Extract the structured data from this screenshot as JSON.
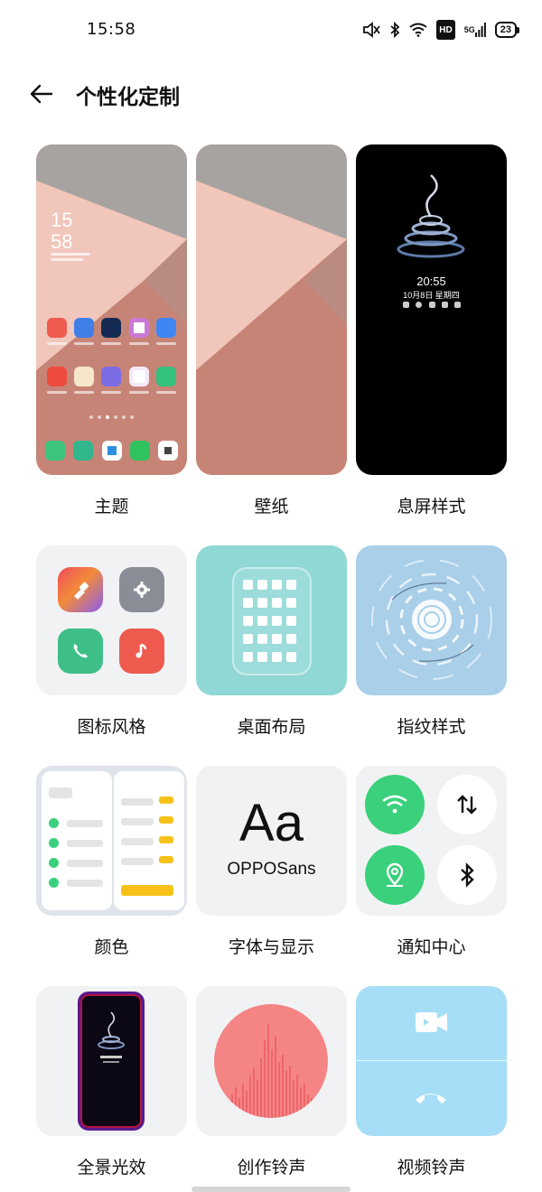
{
  "status_bar": {
    "time": "15:58",
    "battery": "23",
    "hd": "HD",
    "signal": "5G"
  },
  "header": {
    "title": "个性化定制",
    "back_icon": "arrow-left-icon"
  },
  "items": {
    "theme": {
      "label": "主题",
      "clock": "15\n58"
    },
    "wallpaper": {
      "label": "壁纸"
    },
    "aod": {
      "label": "息屏样式",
      "time": "20:55",
      "date": "10月8日 星期四"
    },
    "icon_style": {
      "label": "图标风格"
    },
    "layout": {
      "label": "桌面布局"
    },
    "fingerprint": {
      "label": "指纹样式"
    },
    "color": {
      "label": "颜色"
    },
    "font": {
      "label": "字体与显示",
      "sample": "Aa",
      "font_name": "OPPOSans"
    },
    "notification": {
      "label": "通知中心"
    },
    "panorama": {
      "label": "全景光效"
    },
    "ringtone": {
      "label": "创作铃声"
    },
    "video_ringtone": {
      "label": "视频铃声"
    }
  },
  "colors": {
    "accent_green": "#3ad07c",
    "accent_yellow": "#f6c21a",
    "wallpaper_grey": "#a7a3a0",
    "wallpaper_pink": "#f1c6bb",
    "wallpaper_rose": "#c68477"
  }
}
